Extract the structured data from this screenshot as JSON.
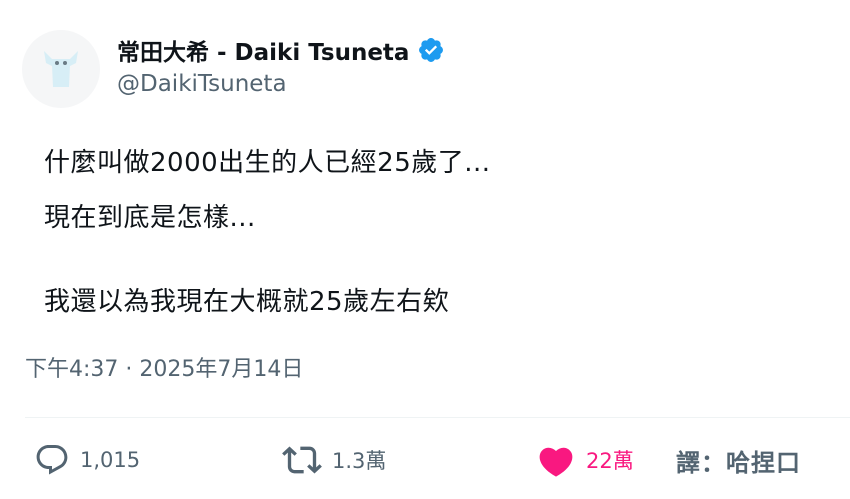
{
  "author": {
    "display_name": "常田大希 - Daiki Tsuneta",
    "handle": "@DaikiTsuneta",
    "verified": true,
    "avatar_icon": "white-dog-mascot"
  },
  "tweet": {
    "lines": [
      "什麼叫做2000出生的人已經25歲了...",
      "現在到底是怎樣...",
      "我還以為我現在大概就25歲左右欸"
    ],
    "timestamp": "下午4:37 · 2025年7月14日"
  },
  "actions": {
    "reply_count": "1,015",
    "retweet_count": "1.3萬",
    "like_count": "22萬",
    "translate_label": "譯：哈捏口"
  },
  "colors": {
    "text": "#0f1419",
    "secondary": "#536471",
    "verified": "#1d9bf0",
    "like": "#f91880"
  }
}
